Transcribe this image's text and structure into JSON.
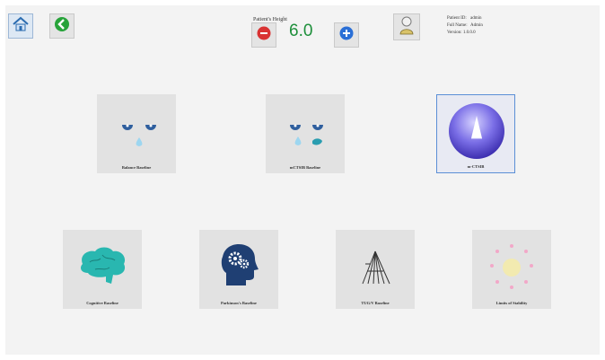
{
  "toolbar": {
    "home_icon": "home-icon",
    "back_icon": "back-arrow-icon",
    "profile_icon": "person-icon"
  },
  "stepper": {
    "caption": "Patient's Height",
    "value": "6.0",
    "minus_icon": "minus-icon",
    "plus_icon": "plus-icon"
  },
  "patient": {
    "id_label": "Patient ID:",
    "id_value": "admin",
    "name_label": "Full Name:",
    "name_value": "Admin",
    "version_label": "Version:",
    "version_value": "1.0.0.0"
  },
  "tiles": [
    {
      "label": "Balance Baseline",
      "icon": "eyes-drop-icon"
    },
    {
      "label": "mCTSIB Baseline",
      "icon": "eyes-foam-icon"
    },
    {
      "label": "m-CTSIB",
      "icon": "cone-sphere-icon",
      "selected": true
    },
    {
      "label": "Cognitive Baseline",
      "icon": "brain-icon"
    },
    {
      "label": "Parkinson's Baseline",
      "icon": "head-gears-icon"
    },
    {
      "label": "TUG/V Baseline",
      "icon": "legs-lines-icon"
    },
    {
      "label": "Limits of Stability",
      "icon": "dots-circle-icon"
    }
  ],
  "colors": {
    "selection_border": "#5b8fd6",
    "stepper_value": "#1d8f3a",
    "minus_button": "#d93333",
    "plus_button": "#2a6fd6"
  }
}
